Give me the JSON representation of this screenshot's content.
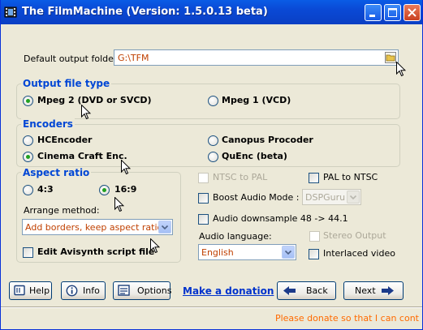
{
  "window": {
    "title": "The FilmMachine    (Version: 1.5.0.13 beta)",
    "minimize_icon": "minimize-icon",
    "maximize_icon": "maximize-icon",
    "close_icon": "close-icon"
  },
  "output_folder": {
    "label": "Default output folder:",
    "value": "G:\\TFM",
    "browse_icon": "folder-icon"
  },
  "output_file_type": {
    "title": "Output file type",
    "options": [
      {
        "label": "Mpeg 2 (DVD or SVCD)",
        "selected": true
      },
      {
        "label": "Mpeg 1 (VCD)",
        "selected": false
      }
    ]
  },
  "encoders": {
    "title": "Encoders",
    "options": [
      {
        "label": "HCEncoder",
        "selected": false
      },
      {
        "label": "Canopus Procoder",
        "selected": false
      },
      {
        "label": "Cinema Craft Enc.",
        "selected": true
      },
      {
        "label": "QuEnc (beta)",
        "selected": false
      }
    ]
  },
  "aspect_ratio": {
    "title": "Aspect ratio",
    "options": [
      {
        "label": "4:3",
        "selected": false
      },
      {
        "label": "16:9",
        "selected": true
      }
    ],
    "arrange_label": "Arrange method:",
    "arrange_value": "Add borders, keep aspect ratio",
    "edit_avisynth_label": "Edit Avisynth script file"
  },
  "options": {
    "ntsc_to_pal": "NTSC to PAL",
    "pal_to_ntsc": "PAL to NTSC",
    "boost_audio_label": "Boost Audio Mode :",
    "boost_audio_value": "DSPGuru",
    "audio_downsample": "Audio downsample 48 -> 44.1",
    "audio_language_label": "Audio language:",
    "audio_language_value": "English",
    "stereo_output": "Stereo Output",
    "interlaced_video": "Interlaced video"
  },
  "buttons": {
    "help": "Help",
    "info": "Info",
    "options": "Options",
    "donation": "Make a donation",
    "back": "Back",
    "next": "Next"
  },
  "status": {
    "text": "Please donate so that I can cont"
  },
  "colors": {
    "title_bar": "#0a49d5",
    "section_title": "#0046d5",
    "value_text": "#c04000",
    "status_text": "#ff6a00",
    "link": "#0033cc"
  }
}
